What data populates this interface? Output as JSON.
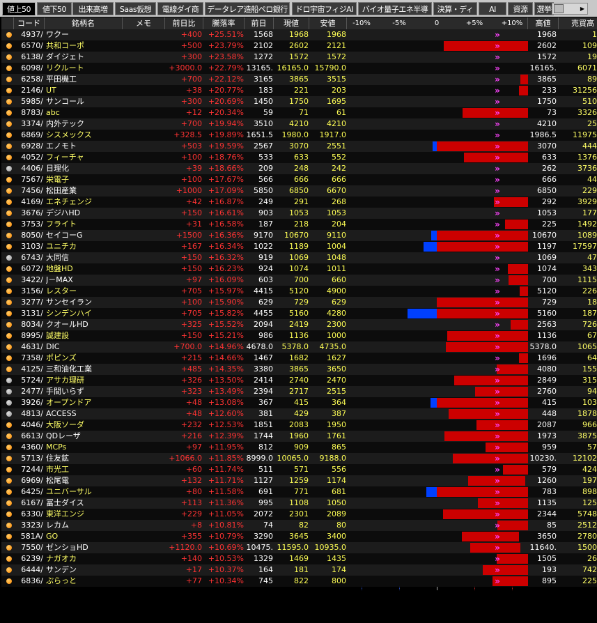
{
  "tabs": [
    {
      "label": "値上50",
      "active": true
    },
    {
      "label": "値下50",
      "active": false
    },
    {
      "label": "出来高増",
      "active": false
    },
    {
      "label": "Saas仮想",
      "active": false
    },
    {
      "label": "電線ダイ商",
      "active": false
    },
    {
      "label": "データレア造船ペロ銀行",
      "active": false
    },
    {
      "label": "ドロ宇宙フィジAI",
      "active": false
    },
    {
      "label": "バイオ量子エネ半導",
      "active": false
    },
    {
      "label": "決算・ディ",
      "active": false
    },
    {
      "label": "AI",
      "active": false
    },
    {
      "label": "資源",
      "active": false
    },
    {
      "label": "選挙",
      "active": false
    }
  ],
  "headers": {
    "code": "コード",
    "name": "銘柄名",
    "memo": "メモ",
    "change": "前日比",
    "pct": "騰落率",
    "prev": "前日",
    "current": "現値",
    "low": "安値",
    "scale": [
      "-10%",
      "-5%",
      "0",
      "+5%",
      "+10%"
    ],
    "high": "高値",
    "volume": "売買高"
  },
  "colors": {
    "up": "#ff3333",
    "name_yellow": "#ffff66",
    "bar_red": "#cc0000",
    "bar_blue": "#0040ff",
    "dot_orange": "#ff8800",
    "dot_gray": "#9a9a9a",
    "arrow_magenta": "#ff44ff"
  },
  "rows": [
    {
      "dot": "orange",
      "code": "4937/",
      "name": "ワクー",
      "nameColor": "white",
      "change": "+400",
      "pct": "+25.51%",
      "prev": "1568",
      "current": "1968",
      "low": "1968",
      "high": "1968",
      "volume": "1",
      "barStart": 25.51,
      "barEnd": 25.51,
      "arrow": true
    },
    {
      "dot": "orange",
      "code": "6570/",
      "name": "共和コーポ",
      "nameColor": "yellow",
      "change": "+500",
      "pct": "+23.79%",
      "prev": "2102",
      "current": "2602",
      "low": "2121",
      "high": "2602",
      "volume": "109",
      "barStart": 0.9,
      "barEnd": 23.79,
      "arrow": true
    },
    {
      "dot": "orange",
      "code": "6138/",
      "name": "ダイジェト",
      "nameColor": "white",
      "change": "+300",
      "pct": "+23.58%",
      "prev": "1272",
      "current": "1572",
      "low": "1572",
      "high": "1572",
      "volume": "19",
      "barStart": 23.58,
      "barEnd": 23.58,
      "arrow": true
    },
    {
      "dot": "orange",
      "code": "6098/",
      "name": "リクルート",
      "nameColor": "yellow",
      "change": "+3000.0",
      "pct": "+22.79%",
      "prev": "13165.",
      "current": "16165.0",
      "low": "15790.0",
      "high": "16165.",
      "volume": "6071",
      "barStart": 19.9,
      "barEnd": 22.79,
      "arrow": true
    },
    {
      "dot": "orange",
      "code": "6258/",
      "name": "平田機工",
      "nameColor": "white",
      "change": "+700",
      "pct": "+22.12%",
      "prev": "3165",
      "current": "3865",
      "low": "3515",
      "high": "3865",
      "volume": "89",
      "barStart": 11.1,
      "barEnd": 22.12,
      "arrow": true
    },
    {
      "dot": "orange",
      "code": "2146/",
      "name": "UT",
      "nameColor": "yellow",
      "change": "+38",
      "pct": "+20.77%",
      "prev": "183",
      "current": "221",
      "low": "203",
      "high": "233",
      "volume": "31256",
      "barStart": 10.9,
      "barEnd": 27.3,
      "arrow": true
    },
    {
      "dot": "orange",
      "code": "5985/",
      "name": "サンコール",
      "nameColor": "white",
      "change": "+300",
      "pct": "+20.69%",
      "prev": "1450",
      "current": "1750",
      "low": "1695",
      "high": "1750",
      "volume": "510",
      "barStart": 16.9,
      "barEnd": 20.69,
      "arrow": true
    },
    {
      "dot": "orange",
      "code": "8783/",
      "name": "abc",
      "nameColor": "yellow",
      "change": "+12",
      "pct": "+20.34%",
      "prev": "59",
      "current": "71",
      "low": "61",
      "high": "73",
      "volume": "3326",
      "barStart": 3.4,
      "barEnd": 23.7,
      "arrow": true
    },
    {
      "dot": "orange",
      "code": "3374/",
      "name": "内外テック",
      "nameColor": "white",
      "change": "+700",
      "pct": "+19.94%",
      "prev": "3510",
      "current": "4210",
      "low": "4210",
      "high": "4210",
      "volume": "25",
      "barStart": 19.94,
      "barEnd": 19.94,
      "arrow": true
    },
    {
      "dot": "orange",
      "code": "6869/",
      "name": "シスメックス",
      "nameColor": "yellow",
      "change": "+328.5",
      "pct": "+19.89%",
      "prev": "1651.5",
      "current": "1980.0",
      "low": "1917.0",
      "high": "1986.5",
      "volume": "11975",
      "barStart": 16.1,
      "barEnd": 20.3,
      "arrow": true
    },
    {
      "dot": "orange",
      "code": "6928/",
      "name": "エノモト",
      "nameColor": "white",
      "change": "+503",
      "pct": "+19.59%",
      "prev": "2567",
      "current": "3070",
      "low": "2551",
      "high": "3070",
      "volume": "444",
      "barStart": -0.6,
      "barEnd": 19.59,
      "arrow": true
    },
    {
      "dot": "orange",
      "code": "4052/",
      "name": "フィーチャ",
      "nameColor": "yellow",
      "change": "+100",
      "pct": "+18.76%",
      "prev": "533",
      "current": "633",
      "low": "552",
      "high": "633",
      "volume": "1376",
      "barStart": 3.6,
      "barEnd": 18.76,
      "arrow": true
    },
    {
      "dot": "gray",
      "code": "4406/",
      "name": "日理化",
      "nameColor": "white",
      "change": "+39",
      "pct": "+18.66%",
      "prev": "209",
      "current": "248",
      "low": "242",
      "high": "262",
      "volume": "3736",
      "barStart": 15.8,
      "barEnd": 25.4,
      "arrow": true
    },
    {
      "dot": "orange",
      "code": "7567/",
      "name": "栄電子",
      "nameColor": "yellow",
      "change": "+100",
      "pct": "+17.67%",
      "prev": "566",
      "current": "666",
      "low": "666",
      "high": "666",
      "volume": "44",
      "barStart": 17.67,
      "barEnd": 17.67,
      "arrow": true
    },
    {
      "dot": "orange",
      "code": "7456/",
      "name": "松田産業",
      "nameColor": "white",
      "change": "+1000",
      "pct": "+17.09%",
      "prev": "5850",
      "current": "6850",
      "low": "6670",
      "high": "6850",
      "volume": "229",
      "barStart": 14.0,
      "barEnd": 17.09,
      "arrow": true
    },
    {
      "dot": "orange",
      "code": "4169/",
      "name": "エネチェンジ",
      "nameColor": "yellow",
      "change": "+42",
      "pct": "+16.87%",
      "prev": "249",
      "current": "291",
      "low": "268",
      "high": "292",
      "volume": "3929",
      "barStart": 7.6,
      "barEnd": 17.3,
      "arrow": true
    },
    {
      "dot": "orange",
      "code": "3676/",
      "name": "デジハHD",
      "nameColor": "white",
      "change": "+150",
      "pct": "+16.61%",
      "prev": "903",
      "current": "1053",
      "low": "1053",
      "high": "1053",
      "volume": "177",
      "barStart": 16.61,
      "barEnd": 16.61,
      "arrow": true
    },
    {
      "dot": "orange",
      "code": "3753/",
      "name": "フライト",
      "nameColor": "yellow",
      "change": "+31",
      "pct": "+16.58%",
      "prev": "187",
      "current": "218",
      "low": "204",
      "high": "225",
      "volume": "1492",
      "barStart": 9.1,
      "barEnd": 20.3,
      "arrow": true
    },
    {
      "dot": "orange",
      "code": "8050/",
      "name": "セイコーG",
      "nameColor": "white",
      "change": "+1500",
      "pct": "+16.36%",
      "prev": "9170",
      "current": "10670",
      "low": "9110",
      "high": "10670",
      "volume": "1089",
      "barStart": -0.7,
      "barEnd": 16.36,
      "arrow": true
    },
    {
      "dot": "orange",
      "code": "3103/",
      "name": "ユニチカ",
      "nameColor": "yellow",
      "change": "+167",
      "pct": "+16.34%",
      "prev": "1022",
      "current": "1189",
      "low": "1004",
      "high": "1197",
      "volume": "17597",
      "barStart": -1.8,
      "barEnd": 17.1,
      "arrow": true
    },
    {
      "dot": "gray",
      "code": "6743/",
      "name": "大同信",
      "nameColor": "white",
      "change": "+150",
      "pct": "+16.32%",
      "prev": "919",
      "current": "1069",
      "low": "1048",
      "high": "1069",
      "volume": "47",
      "barStart": 14.0,
      "barEnd": 16.32,
      "arrow": true
    },
    {
      "dot": "orange",
      "code": "6072/",
      "name": "地盤HD",
      "nameColor": "yellow",
      "change": "+150",
      "pct": "+16.23%",
      "prev": "924",
      "current": "1074",
      "low": "1011",
      "high": "1074",
      "volume": "343",
      "barStart": 9.4,
      "barEnd": 16.23,
      "arrow": true
    },
    {
      "dot": "orange",
      "code": "3422/",
      "name": "J－MAX",
      "nameColor": "white",
      "change": "+97",
      "pct": "+16.09%",
      "prev": "603",
      "current": "700",
      "low": "660",
      "high": "700",
      "volume": "1115",
      "barStart": 9.5,
      "barEnd": 16.09,
      "arrow": true
    },
    {
      "dot": "orange",
      "code": "3156/",
      "name": "レスター",
      "nameColor": "yellow",
      "change": "+705",
      "pct": "+15.97%",
      "prev": "4415",
      "current": "5120",
      "low": "4900",
      "high": "5120",
      "volume": "226",
      "barStart": 11.0,
      "barEnd": 15.97,
      "arrow": true
    },
    {
      "dot": "orange",
      "code": "3277/",
      "name": "サンセイラン",
      "nameColor": "white",
      "change": "+100",
      "pct": "+15.90%",
      "prev": "629",
      "current": "729",
      "low": "629",
      "high": "729",
      "volume": "18",
      "barStart": 0.0,
      "barEnd": 15.9,
      "arrow": true
    },
    {
      "dot": "orange",
      "code": "3131/",
      "name": "シンデンハイ",
      "nameColor": "yellow",
      "change": "+705",
      "pct": "+15.82%",
      "prev": "4455",
      "current": "5160",
      "low": "4280",
      "high": "5160",
      "volume": "187",
      "barStart": -3.9,
      "barEnd": 15.82,
      "arrow": true
    },
    {
      "dot": "orange",
      "code": "8034/",
      "name": "クオールHD",
      "nameColor": "white",
      "change": "+325",
      "pct": "+15.52%",
      "prev": "2094",
      "current": "2419",
      "low": "2300",
      "high": "2563",
      "volume": "726",
      "barStart": 9.8,
      "barEnd": 22.4,
      "arrow": true
    },
    {
      "dot": "orange",
      "code": "8995/",
      "name": "誠建設",
      "nameColor": "yellow",
      "change": "+150",
      "pct": "+15.21%",
      "prev": "986",
      "current": "1136",
      "low": "1000",
      "high": "1136",
      "volume": "67",
      "barStart": 1.4,
      "barEnd": 15.21,
      "arrow": true
    },
    {
      "dot": "orange",
      "code": "4631/",
      "name": "DIC",
      "nameColor": "white",
      "change": "+700.0",
      "pct": "+14.96%",
      "prev": "4678.0",
      "current": "5378.0",
      "low": "4735.0",
      "high": "5378.0",
      "volume": "1065",
      "barStart": 1.2,
      "barEnd": 14.96,
      "arrow": true
    },
    {
      "dot": "orange",
      "code": "7358/",
      "name": "ポピンズ",
      "nameColor": "yellow",
      "change": "+215",
      "pct": "+14.66%",
      "prev": "1467",
      "current": "1682",
      "low": "1627",
      "high": "1696",
      "volume": "64",
      "barStart": 10.9,
      "barEnd": 15.6,
      "arrow": true
    },
    {
      "dot": "orange",
      "code": "4125/",
      "name": "三和油化工業",
      "nameColor": "white",
      "change": "+485",
      "pct": "+14.35%",
      "prev": "3380",
      "current": "3865",
      "low": "3650",
      "high": "4080",
      "volume": "155",
      "barStart": 8.0,
      "barEnd": 20.7,
      "arrow": true
    },
    {
      "dot": "gray",
      "code": "5724/",
      "name": "アサカ理研",
      "nameColor": "yellow",
      "change": "+326",
      "pct": "+13.50%",
      "prev": "2414",
      "current": "2740",
      "low": "2470",
      "high": "2849",
      "volume": "315",
      "barStart": 2.3,
      "barEnd": 18.0,
      "arrow": true
    },
    {
      "dot": "gray",
      "code": "2477/",
      "name": "手間いらず",
      "nameColor": "white",
      "change": "+323",
      "pct": "+13.49%",
      "prev": "2394",
      "current": "2717",
      "low": "2515",
      "high": "2760",
      "volume": "94",
      "barStart": 5.1,
      "barEnd": 15.3,
      "arrow": true
    },
    {
      "dot": "gray",
      "code": "3926/",
      "name": "オープンドア",
      "nameColor": "yellow",
      "change": "+48",
      "pct": "+13.08%",
      "prev": "367",
      "current": "415",
      "low": "364",
      "high": "415",
      "volume": "103",
      "barStart": -0.8,
      "barEnd": 13.08,
      "arrow": true
    },
    {
      "dot": "gray",
      "code": "4813/",
      "name": "ACCESS",
      "nameColor": "white",
      "change": "+48",
      "pct": "+12.60%",
      "prev": "381",
      "current": "429",
      "low": "387",
      "high": "448",
      "volume": "1878",
      "barStart": 1.6,
      "barEnd": 17.6,
      "arrow": true
    },
    {
      "dot": "orange",
      "code": "4046/",
      "name": "大阪ソーダ",
      "nameColor": "yellow",
      "change": "+232",
      "pct": "+12.53%",
      "prev": "1851",
      "current": "2083",
      "low": "1950",
      "high": "2087",
      "volume": "966",
      "barStart": 5.3,
      "barEnd": 12.75,
      "arrow": true
    },
    {
      "dot": "orange",
      "code": "6613/",
      "name": "QDレーザ",
      "nameColor": "white",
      "change": "+216",
      "pct": "+12.39%",
      "prev": "1744",
      "current": "1960",
      "low": "1761",
      "high": "1973",
      "volume": "3875",
      "barStart": 1.0,
      "barEnd": 13.1,
      "arrow": true
    },
    {
      "dot": "orange",
      "code": "4360/",
      "name": "MCPs",
      "nameColor": "yellow",
      "change": "+97",
      "pct": "+11.95%",
      "prev": "812",
      "current": "909",
      "low": "865",
      "high": "959",
      "volume": "57",
      "barStart": 6.5,
      "barEnd": 18.1,
      "arrow": true
    },
    {
      "dot": "orange",
      "code": "5713/",
      "name": "住友鉱",
      "nameColor": "white",
      "change": "+1066.0",
      "pct": "+11.85%",
      "prev": "8999.0",
      "current": "10065.0",
      "low": "9188.0",
      "high": "10230.",
      "volume": "12102",
      "barStart": 2.1,
      "barEnd": 13.7,
      "arrow": true
    },
    {
      "dot": "orange",
      "code": "7244/",
      "name": "市光工",
      "nameColor": "yellow",
      "change": "+60",
      "pct": "+11.74%",
      "prev": "511",
      "current": "571",
      "low": "556",
      "high": "579",
      "volume": "424",
      "barStart": 8.8,
      "barEnd": 13.3,
      "arrow": true
    },
    {
      "dot": "orange",
      "code": "6969/",
      "name": "松尾電",
      "nameColor": "white",
      "change": "+132",
      "pct": "+11.71%",
      "prev": "1127",
      "current": "1259",
      "low": "1174",
      "high": "1260",
      "volume": "197",
      "barStart": 4.2,
      "barEnd": 11.8,
      "arrow": true
    },
    {
      "dot": "orange",
      "code": "6425/",
      "name": "ユニバーサル",
      "nameColor": "yellow",
      "change": "+80",
      "pct": "+11.58%",
      "prev": "691",
      "current": "771",
      "low": "681",
      "high": "783",
      "volume": "898",
      "barStart": -1.4,
      "barEnd": 13.3,
      "arrow": true
    },
    {
      "dot": "orange",
      "code": "6167/",
      "name": "冨士ダイス",
      "nameColor": "white",
      "change": "+113",
      "pct": "+11.36%",
      "prev": "995",
      "current": "1108",
      "low": "1050",
      "high": "1135",
      "volume": "125",
      "barStart": 5.5,
      "barEnd": 14.1,
      "arrow": true
    },
    {
      "dot": "orange",
      "code": "6330/",
      "name": "東洋エンジ",
      "nameColor": "yellow",
      "change": "+229",
      "pct": "+11.05%",
      "prev": "2072",
      "current": "2301",
      "low": "2089",
      "high": "2344",
      "volume": "5748",
      "barStart": 0.8,
      "barEnd": 13.1,
      "arrow": true
    },
    {
      "dot": "orange",
      "code": "3323/",
      "name": "レカム",
      "nameColor": "white",
      "change": "+8",
      "pct": "+10.81%",
      "prev": "74",
      "current": "82",
      "low": "80",
      "high": "85",
      "volume": "2512",
      "barStart": 8.1,
      "barEnd": 14.9,
      "arrow": true
    },
    {
      "dot": "orange",
      "code": "581A/",
      "name": "GO",
      "nameColor": "yellow",
      "change": "+355",
      "pct": "+10.79%",
      "prev": "3290",
      "current": "3645",
      "low": "3400",
      "high": "3650",
      "volume": "2780",
      "barStart": 3.3,
      "barEnd": 10.9,
      "arrow": true
    },
    {
      "dot": "orange",
      "code": "7550/",
      "name": "ゼンショHD",
      "nameColor": "white",
      "change": "+1120.0",
      "pct": "+10.69%",
      "prev": "10475.",
      "current": "11595.0",
      "low": "10935.0",
      "high": "11640.",
      "volume": "1500",
      "barStart": 4.4,
      "barEnd": 11.1,
      "arrow": true
    },
    {
      "dot": "orange",
      "code": "6239/",
      "name": "ナガオカ",
      "nameColor": "yellow",
      "change": "+140",
      "pct": "+10.53%",
      "prev": "1329",
      "current": "1469",
      "low": "1435",
      "high": "1505",
      "volume": "26",
      "barStart": 8.0,
      "barEnd": 13.2,
      "arrow": true
    },
    {
      "dot": "orange",
      "code": "6444/",
      "name": "サンデン",
      "nameColor": "white",
      "change": "+17",
      "pct": "+10.37%",
      "prev": "164",
      "current": "181",
      "low": "174",
      "high": "193",
      "volume": "742",
      "barStart": 6.1,
      "barEnd": 17.7,
      "arrow": true
    },
    {
      "dot": "orange",
      "code": "6836/",
      "name": "ぷらっと",
      "nameColor": "yellow",
      "change": "+77",
      "pct": "+10.34%",
      "prev": "745",
      "current": "822",
      "low": "800",
      "high": "895",
      "volume": "225",
      "barStart": 7.4,
      "barEnd": 20.1,
      "arrow": true
    }
  ]
}
